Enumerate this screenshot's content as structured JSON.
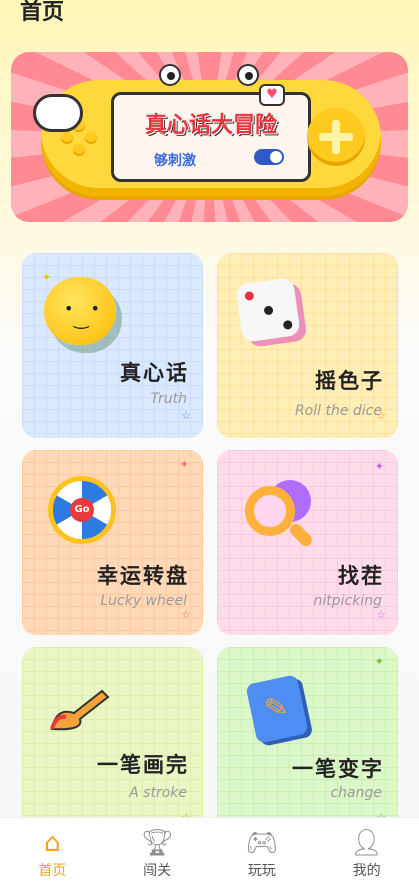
{
  "header": {
    "title": "首页"
  },
  "banner": {
    "title": "真心话大冒险",
    "subtitle": "够刺激",
    "heart_icon": "heart-icon"
  },
  "cards": [
    {
      "title": "真心话",
      "subtitle": "Truth",
      "icon": "smiley-face-icon",
      "bg": "#dbe9ff"
    },
    {
      "title": "摇色子",
      "subtitle": "Roll the dice",
      "icon": "dice-icon",
      "bg": "#ffeeb8"
    },
    {
      "title": "幸运转盘",
      "subtitle": "Lucky wheel",
      "icon": "lucky-wheel-icon",
      "wheel_label": "Go",
      "bg": "#ffd9b8"
    },
    {
      "title": "找茬",
      "subtitle": "nitpicking",
      "icon": "magnifier-icon",
      "bg": "#ffdcea"
    },
    {
      "title": "一笔画完",
      "subtitle": "A stroke",
      "icon": "paintbrush-icon",
      "bg": "#eaf7c5"
    },
    {
      "title": "一笔变字",
      "subtitle": "change",
      "icon": "pencil-pad-icon",
      "bg": "#dcf7c9"
    }
  ],
  "tabbar": {
    "items": [
      {
        "label": "首页",
        "icon": "home-icon",
        "active": true
      },
      {
        "label": "闯关",
        "icon": "trophy-icon",
        "active": false
      },
      {
        "label": "玩玩",
        "icon": "gamepad-icon",
        "active": false
      },
      {
        "label": "我的",
        "icon": "user-icon",
        "active": false
      }
    ]
  },
  "colors": {
    "accent": "#ff9f1c",
    "banner_red": "#e8343f"
  }
}
